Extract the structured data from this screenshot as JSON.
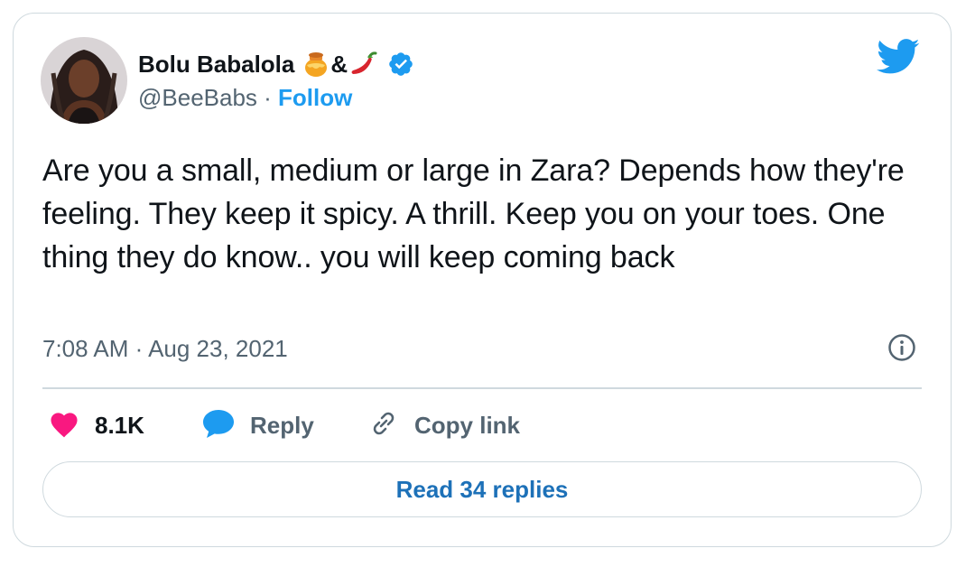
{
  "author": {
    "name": "Bolu Babalola",
    "name_separator": "&",
    "handle": "@BeeBabs",
    "handle_separator": " · ",
    "follow_label": "Follow"
  },
  "tweet": {
    "text": "Are you a small, medium or large in Zara? Depends how they're feeling. They keep it spicy. A thrill.  Keep you on your toes. One thing they do know.. you will keep coming back",
    "timestamp": "7:08 AM · Aug 23, 2021"
  },
  "actions": {
    "like_count": "8.1K",
    "reply_label": "Reply",
    "copy_label": "Copy link"
  },
  "read_replies_label": "Read 34 replies",
  "colors": {
    "accent": "#1d9bf0",
    "like": "#f91880",
    "text": "#0f1419",
    "muted": "#536471",
    "border": "#cfd9de"
  },
  "icons": [
    "honey-pot-icon",
    "chili-pepper-icon",
    "verified-badge-icon",
    "twitter-bird-icon",
    "info-icon",
    "heart-icon",
    "reply-bubble-icon",
    "link-icon"
  ]
}
